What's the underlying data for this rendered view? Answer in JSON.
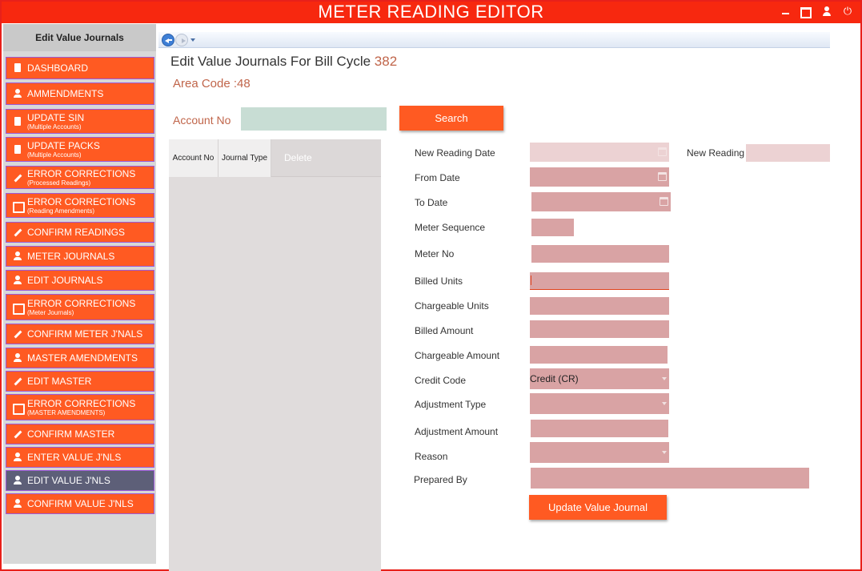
{
  "app": {
    "title": "METER READING EDITOR"
  },
  "sidebar": {
    "header": "Edit Value Journals",
    "items": [
      {
        "label": "DASHBOARD",
        "sub": "",
        "icon": "document-icon",
        "active": false
      },
      {
        "label": "AMMENDMENTS",
        "sub": "",
        "icon": "user-icon",
        "active": false
      },
      {
        "label": "UPDATE SIN",
        "sub": "(Multiple Accounts)",
        "icon": "document-icon",
        "active": false
      },
      {
        "label": "UPDATE PACKS",
        "sub": "(Multiple Accounts)",
        "icon": "document-icon",
        "active": false
      },
      {
        "label": "ERROR CORRECTIONS",
        "sub": "(Processed Readings)",
        "icon": "pen-icon",
        "active": false
      },
      {
        "label": "ERROR CORRECTIONS",
        "sub": "(Reading Amendments)",
        "icon": "list-icon",
        "active": false
      },
      {
        "label": "CONFIRM READINGS",
        "sub": "",
        "icon": "pen-icon",
        "active": false
      },
      {
        "label": "METER JOURNALS",
        "sub": "",
        "icon": "user-icon",
        "active": false
      },
      {
        "label": "EDIT JOURNALS",
        "sub": "",
        "icon": "user-icon",
        "active": false
      },
      {
        "label": "ERROR CORRECTIONS",
        "sub": "(Meter Journals)",
        "icon": "list-icon",
        "active": false
      },
      {
        "label": "CONFIRM METER J'NALS",
        "sub": "",
        "icon": "pen-icon",
        "active": false
      },
      {
        "label": "MASTER AMENDMENTS",
        "sub": "",
        "icon": "user-icon",
        "active": false
      },
      {
        "label": "EDIT MASTER",
        "sub": "",
        "icon": "pen-icon",
        "active": false
      },
      {
        "label": "ERROR CORRECTIONS",
        "sub": "(MASTER AMENDMENTS)",
        "icon": "list-icon",
        "active": false
      },
      {
        "label": "CONFIRM MASTER",
        "sub": "",
        "icon": "pen-icon",
        "active": false
      },
      {
        "label": "ENTER VALUE J'NLS",
        "sub": "",
        "icon": "user-icon",
        "active": false
      },
      {
        "label": "EDIT VALUE J'NLS",
        "sub": "",
        "icon": "user-icon",
        "active": true
      },
      {
        "label": "CONFIRM VALUE J'NLS",
        "sub": "",
        "icon": "user-icon",
        "active": false
      }
    ]
  },
  "main": {
    "title": "Edit Value Journals For Bill Cycle",
    "bill_cycle": "382",
    "area_code": "Area Code :48",
    "account_label": "Account No",
    "account_value": "",
    "search_label": "Search",
    "grid": {
      "columns": [
        "Account No",
        "Journal Type",
        "Delete"
      ]
    },
    "form": {
      "new_reading_date": "New Reading Date",
      "new_reading": "New Reading",
      "from_date": "From Date",
      "to_date": "To Date",
      "meter_sequence": "Meter Sequence",
      "meter_no": "Meter No",
      "billed_units": "Billed Units",
      "chargeable_units": "Chargeable Units",
      "billed_amount": "Billed Amount",
      "chargeable_amount": "Chargeable Amount",
      "credit_code": "Credit Code",
      "credit_code_value": "Credit (CR)",
      "adjustment_type": "Adjustment Type",
      "adjustment_amount": "Adjustment Amount",
      "reason": "Reason",
      "prepared_by": "Prepared By"
    },
    "update_label": "Update Value Journal"
  },
  "colors": {
    "accent": "#ff5a22",
    "title_bar": "#f7280f",
    "field": "#d9a3a4",
    "active_item": "#5d5f78"
  }
}
